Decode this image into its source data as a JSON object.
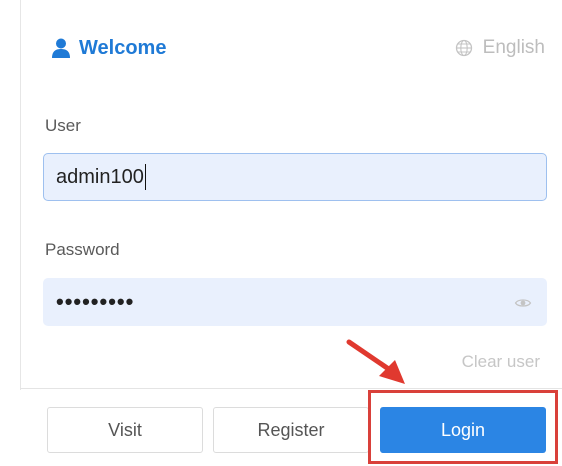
{
  "header": {
    "title": "Welcome",
    "language": "English"
  },
  "form": {
    "user_label": "User",
    "user_value": "admin100",
    "password_label": "Password",
    "password_masked": "•••••••••",
    "clear_user": "Clear user"
  },
  "buttons": {
    "visit": "Visit",
    "register": "Register",
    "login": "Login"
  },
  "colors": {
    "accent": "#2b85e4",
    "title": "#1f7ad6",
    "highlight": "#d9403a",
    "field_bg": "#e9f0fd"
  },
  "icons": {
    "title": "user-icon",
    "language": "globe-icon",
    "password_toggle": "eye-icon",
    "annotation": "red-arrow"
  }
}
